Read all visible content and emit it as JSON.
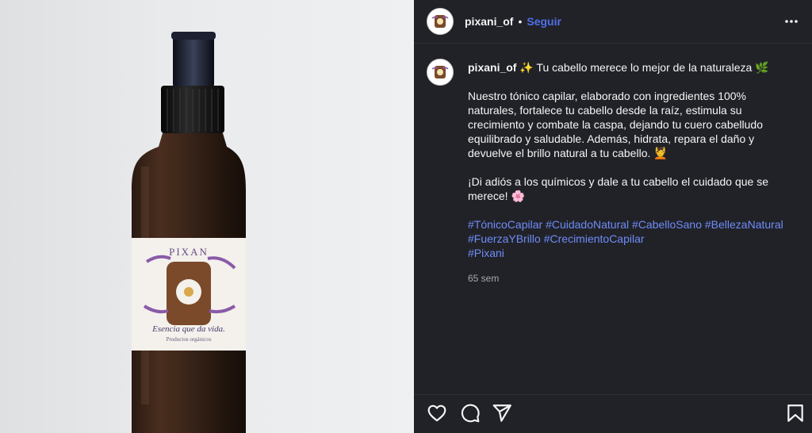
{
  "header": {
    "username": "pixani_of",
    "separator": "•",
    "follow_label": "Seguir"
  },
  "post": {
    "username": "pixani_of",
    "title_line": "✨ Tu cabello merece lo mejor de la naturaleza 🌿",
    "paragraph1": "Nuestro tónico capilar, elaborado con ingredientes 100% naturales, fortalece tu cabello desde la raíz, estimula su crecimiento y combate la caspa, dejando tu cuero cabelludo equilibrado y saludable. Además, hidrata, repara el daño y devuelve el brillo natural a tu cabello. 💆",
    "paragraph2": "¡Di adiós a los químicos y dale a tu cabello el cuidado que se merece! 🌸",
    "hashtags": [
      "#TónicoCapilar",
      "#CuidadoNatural",
      "#CabelloSano",
      "#BellezaNatural",
      "#FuerzaYBrillo",
      "#CrecimientoCapilar",
      "#Pixani"
    ],
    "time": "65 sem"
  },
  "label": {
    "brand": "PIXAN",
    "tagline": "Esencia que da vida.",
    "sub": "Productos orgánicos"
  },
  "icons": {
    "more": "more-options-icon",
    "like": "heart-icon",
    "comment": "comment-icon",
    "share": "share-icon",
    "save": "bookmark-icon"
  },
  "colors": {
    "panel_bg": "#212228",
    "link": "#6f8cf7",
    "follow": "#4f6fe8"
  }
}
